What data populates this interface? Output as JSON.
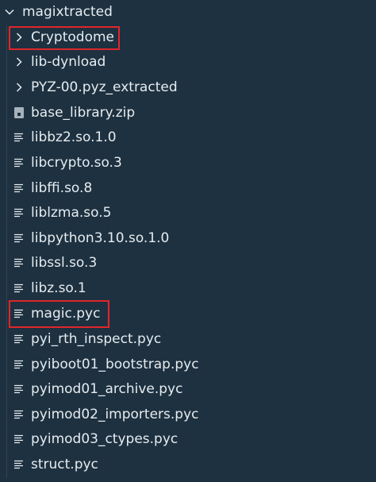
{
  "colors": {
    "background": "#1e3140",
    "text": "#e6ecf0",
    "highlight": "#e0262b"
  },
  "root": {
    "label": "magixtracted",
    "icon": "chevron-down-icon"
  },
  "items": [
    {
      "label": "Cryptodome",
      "icon": "chevron-right-icon"
    },
    {
      "label": "lib-dynload",
      "icon": "chevron-right-icon"
    },
    {
      "label": "PYZ-00.pyz_extracted",
      "icon": "chevron-right-icon"
    },
    {
      "label": "base_library.zip",
      "icon": "zip-file-icon"
    },
    {
      "label": "libbz2.so.1.0",
      "icon": "text-file-icon"
    },
    {
      "label": "libcrypto.so.3",
      "icon": "text-file-icon"
    },
    {
      "label": "libffi.so.8",
      "icon": "text-file-icon"
    },
    {
      "label": "liblzma.so.5",
      "icon": "text-file-icon"
    },
    {
      "label": "libpython3.10.so.1.0",
      "icon": "text-file-icon"
    },
    {
      "label": "libssl.so.3",
      "icon": "text-file-icon"
    },
    {
      "label": "libz.so.1",
      "icon": "text-file-icon"
    },
    {
      "label": "magic.pyc",
      "icon": "text-file-icon"
    },
    {
      "label": "pyi_rth_inspect.pyc",
      "icon": "text-file-icon"
    },
    {
      "label": "pyiboot01_bootstrap.pyc",
      "icon": "text-file-icon"
    },
    {
      "label": "pyimod01_archive.pyc",
      "icon": "text-file-icon"
    },
    {
      "label": "pyimod02_importers.pyc",
      "icon": "text-file-icon"
    },
    {
      "label": "pyimod03_ctypes.pyc",
      "icon": "text-file-icon"
    },
    {
      "label": "struct.pyc",
      "icon": "text-file-icon"
    }
  ]
}
